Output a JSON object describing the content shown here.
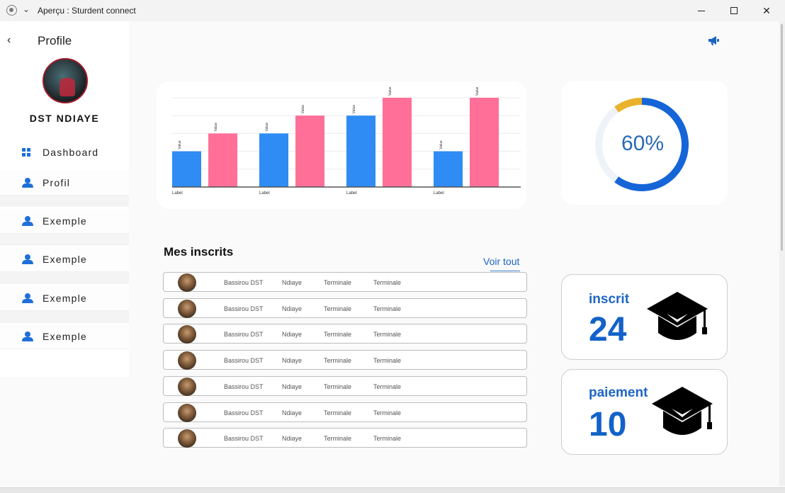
{
  "window": {
    "title": "Aperçu : Sturdent connect",
    "close_symbol": "✕"
  },
  "sidebar": {
    "back_symbol": "‹",
    "title": "Profile",
    "user_name": "DST NDIAYE",
    "items": [
      {
        "label": "Dashboard",
        "icon": "dashboard-icon"
      },
      {
        "label": "Profil",
        "icon": "person-icon"
      },
      {
        "label": "Exemple",
        "icon": "person-icon"
      },
      {
        "label": "Exemple",
        "icon": "person-icon"
      },
      {
        "label": "Exemple",
        "icon": "person-icon"
      },
      {
        "label": "Exemple",
        "icon": "person-icon"
      }
    ]
  },
  "chart_data": {
    "type": "bar",
    "categories": [
      "Label",
      "Label",
      "Label",
      "Label"
    ],
    "series": [
      {
        "color": "#2e8cf4",
        "values": [
          2,
          3,
          4,
          2
        ],
        "value_label": "Value"
      },
      {
        "color": "#ff6f98",
        "values": [
          3,
          4,
          5,
          5
        ],
        "value_label": "Value"
      }
    ],
    "ylim": [
      0,
      5
    ],
    "grid": true,
    "xlabel": "",
    "ylabel": ""
  },
  "progress": {
    "value": 60,
    "label": "60%",
    "segments": [
      {
        "name": "main",
        "color": "#1565d8",
        "start": 0,
        "end": 0.6
      },
      {
        "name": "accent",
        "color": "#e9b22a",
        "start": 0.9,
        "end": 1.0
      }
    ],
    "track_color": "#eef3fa"
  },
  "registrations": {
    "title": "Mes inscrits",
    "see_all": "Voir tout",
    "rows": [
      {
        "name": "Bassirou DST",
        "last_name": "Ndiaye",
        "class": "Terminale",
        "level": "Terminale"
      },
      {
        "name": "Bassirou DST",
        "last_name": "Ndiaye",
        "class": "Terminale",
        "level": "Terminale"
      },
      {
        "name": "Bassirou DST",
        "last_name": "Ndiaye",
        "class": "Terminale",
        "level": "Terminale"
      },
      {
        "name": "Bassirou DST",
        "last_name": "Ndiaye",
        "class": "Terminale",
        "level": "Terminale"
      },
      {
        "name": "Bassirou DST",
        "last_name": "Ndiaye",
        "class": "Terminale",
        "level": "Terminale"
      },
      {
        "name": "Bassirou DST",
        "last_name": "Ndiaye",
        "class": "Terminale",
        "level": "Terminale"
      },
      {
        "name": "Bassirou DST",
        "last_name": "Ndiaye",
        "class": "Terminale",
        "level": "Terminale"
      }
    ]
  },
  "stats": [
    {
      "label": "inscrit",
      "value": "24",
      "icon": "graduation-cap-icon"
    },
    {
      "label": "paiement",
      "value": "10",
      "icon": "graduation-cap-icon"
    }
  ],
  "colors": {
    "accent": "#1e66c4",
    "bar_blue": "#2e8cf4",
    "bar_pink": "#ff6f98"
  }
}
